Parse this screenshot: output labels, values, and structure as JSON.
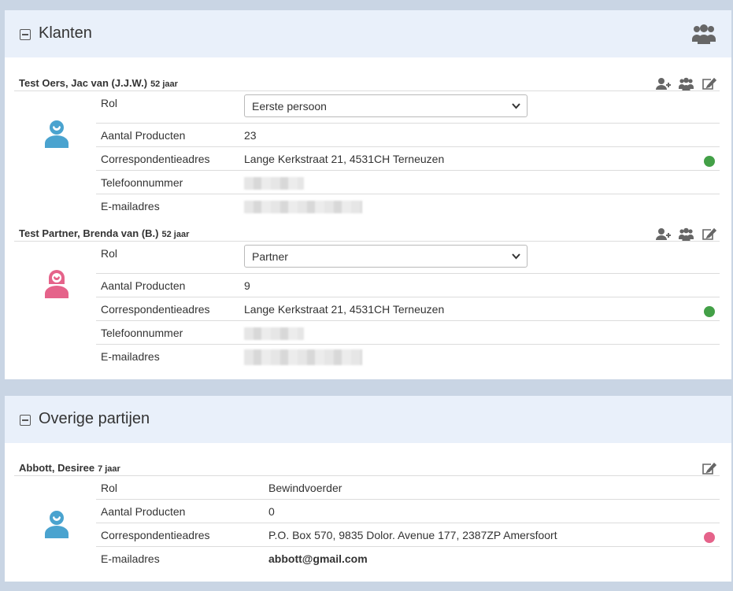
{
  "klanten": {
    "title": "Klanten",
    "icons": {
      "collapse": "collapse-minus-icon",
      "header": "users-group-icon"
    },
    "persons": [
      {
        "name": "Test Oers, Jac van (J.J.W.)",
        "age": "52 jaar",
        "avatar_color": "#4aa3cf",
        "actions": [
          "add-user-icon",
          "users-group-icon",
          "edit-icon"
        ],
        "rows": {
          "rol": {
            "label": "Rol",
            "value": "Eerste persoon"
          },
          "producten": {
            "label": "Aantal Producten",
            "value": "23"
          },
          "adres": {
            "label": "Correspondentieadres",
            "value": "Lange Kerkstraat 21, 4531CH Terneuzen",
            "status_color": "#43a047"
          },
          "telefoon": {
            "label": "Telefoonnummer"
          },
          "email": {
            "label": "E-mailadres"
          }
        }
      },
      {
        "name": "Test Partner, Brenda van (B.)",
        "age": "52 jaar",
        "avatar_color": "#e5638a",
        "actions": [
          "add-user-icon",
          "users-group-icon",
          "edit-icon"
        ],
        "rows": {
          "rol": {
            "label": "Rol",
            "value": "Partner"
          },
          "producten": {
            "label": "Aantal Producten",
            "value": "9"
          },
          "adres": {
            "label": "Correspondentieadres",
            "value": "Lange Kerkstraat 21, 4531CH Terneuzen",
            "status_color": "#43a047"
          },
          "telefoon": {
            "label": "Telefoonnummer"
          },
          "email": {
            "label": "E-mailadres"
          }
        }
      }
    ]
  },
  "overige": {
    "title": "Overige partijen",
    "icons": {
      "collapse": "collapse-minus-icon"
    },
    "persons": [
      {
        "name": "Abbott, Desiree",
        "age": "7 jaar",
        "avatar_color": "#4aa3cf",
        "actions": [
          "edit-icon"
        ],
        "rows": {
          "rol": {
            "label": "Rol",
            "value": "Bewindvoerder"
          },
          "producten": {
            "label": "Aantal Producten",
            "value": "0"
          },
          "adres": {
            "label": "Correspondentieadres",
            "value": "P.O. Box 570, 9835 Dolor. Avenue 177, 2387ZP Amersfoort",
            "status_color": "#e5638a"
          },
          "email": {
            "label": "E-mailadres",
            "value": "abbott@gmail.com"
          }
        }
      }
    ]
  }
}
